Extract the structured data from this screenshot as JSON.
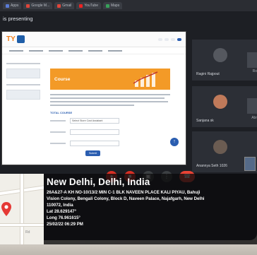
{
  "browser": {
    "tabs": [
      {
        "label": "Apps",
        "kind": "apps"
      },
      {
        "label": "Google M...",
        "kind": "gm"
      },
      {
        "label": "Gmail",
        "kind": "gm"
      },
      {
        "label": "YouTube",
        "kind": "yt"
      },
      {
        "label": "Maps",
        "kind": "maps"
      }
    ]
  },
  "meeting": {
    "presenting_label": "is presenting"
  },
  "shared_site": {
    "logo_text": "TY",
    "course_title": "Course",
    "section_heading": "TOTAL COURSE",
    "field_value": "Select Store Cost Assistant",
    "submit_label": "Submit"
  },
  "participants": [
    {
      "name": "Ragini Rajpout",
      "cut": "Ro"
    },
    {
      "name": "Sanjana sk",
      "cut": "Abr"
    },
    {
      "name": "Anannya Seth 1026",
      "cut": ""
    }
  ],
  "controls": {
    "mic_icon": "mic-icon",
    "cam_icon": "camera-icon",
    "present_icon": "present-icon",
    "more_icon": "more-icon",
    "end_icon": "end-call-icon"
  },
  "gps": {
    "city": "New Delhi, Delhi, India",
    "address_line1": "26A&27-A KH NO-10/13/2 MIN C-1 BLK NAVEEN PLACE KALI PIYAU, Bahuji",
    "address_line2": "Vision Colony, Bengali Colony, Block D, Naveen Palace, Najafgarh, New Delhi",
    "postal": "110072, India",
    "lat": "Lat 28.629147°",
    "long": "Long 76.961615°",
    "timestamp": "25/02/22 06:29 PM",
    "map_label": "Rd"
  },
  "colors": {
    "accent_orange": "#f39a27",
    "end_call_red": "#ea4335",
    "brand_blue": "#2a5db0"
  }
}
